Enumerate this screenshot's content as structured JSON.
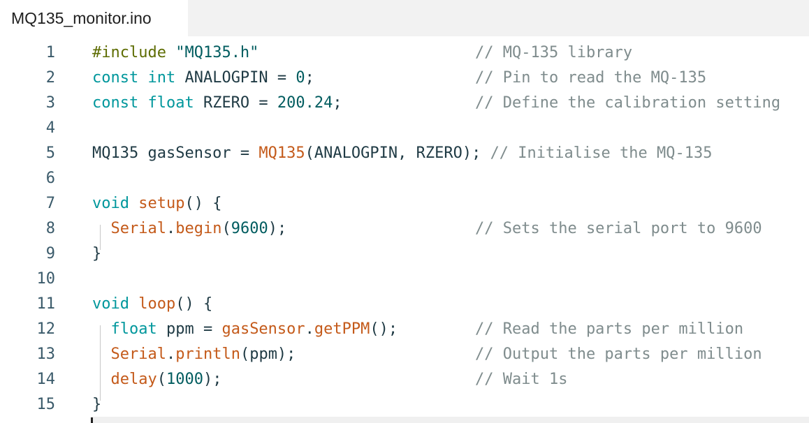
{
  "tab": {
    "title": "MQ135_monitor.ino"
  },
  "editor": {
    "lines": [
      {
        "n": "1",
        "tokens": [
          [
            "pp",
            "#include "
          ],
          [
            "str",
            "\"MQ135.h\""
          ]
        ],
        "comment": "// MQ-135 library"
      },
      {
        "n": "2",
        "tokens": [
          [
            "kw",
            "const int"
          ],
          [
            "tx",
            " ANALOGPIN = "
          ],
          [
            "num",
            "0"
          ],
          [
            "tx",
            ";"
          ]
        ],
        "comment": "// Pin to read the MQ-135"
      },
      {
        "n": "3",
        "tokens": [
          [
            "kw",
            "const float"
          ],
          [
            "tx",
            " RZERO = "
          ],
          [
            "num",
            "200.24"
          ],
          [
            "tx",
            ";"
          ]
        ],
        "comment": "// Define the calibration setting"
      },
      {
        "n": "4",
        "tokens": [],
        "comment": ""
      },
      {
        "n": "5",
        "tokens": [
          [
            "tx",
            "MQ135 gasSensor = "
          ],
          [
            "fn",
            "MQ135"
          ],
          [
            "tx",
            "(ANALOGPIN, RZERO); "
          ],
          [
            "ic",
            "// Initialise the MQ-135"
          ]
        ],
        "comment": ""
      },
      {
        "n": "6",
        "tokens": [],
        "comment": ""
      },
      {
        "n": "7",
        "tokens": [
          [
            "kw",
            "void"
          ],
          [
            "tx",
            " "
          ],
          [
            "fn",
            "setup"
          ],
          [
            "tx",
            "() {"
          ]
        ],
        "comment": ""
      },
      {
        "n": "8",
        "tokens": [
          [
            "tx",
            "  "
          ],
          [
            "fn",
            "Serial"
          ],
          [
            "tx",
            "."
          ],
          [
            "fn",
            "begin"
          ],
          [
            "tx",
            "("
          ],
          [
            "num",
            "9600"
          ],
          [
            "tx",
            ");"
          ]
        ],
        "comment": "// Sets the serial port to 9600"
      },
      {
        "n": "9",
        "tokens": [
          [
            "tx",
            "}"
          ]
        ],
        "comment": ""
      },
      {
        "n": "10",
        "tokens": [],
        "comment": ""
      },
      {
        "n": "11",
        "tokens": [
          [
            "kw",
            "void"
          ],
          [
            "tx",
            " "
          ],
          [
            "fn",
            "loop"
          ],
          [
            "tx",
            "() {"
          ]
        ],
        "comment": ""
      },
      {
        "n": "12",
        "tokens": [
          [
            "tx",
            "  "
          ],
          [
            "kw",
            "float"
          ],
          [
            "tx",
            " ppm = "
          ],
          [
            "fn",
            "gasSensor"
          ],
          [
            "tx",
            "."
          ],
          [
            "fn",
            "getPPM"
          ],
          [
            "tx",
            "();"
          ]
        ],
        "comment": "// Read the parts per million"
      },
      {
        "n": "13",
        "tokens": [
          [
            "tx",
            "  "
          ],
          [
            "fn",
            "Serial"
          ],
          [
            "tx",
            "."
          ],
          [
            "fn",
            "println"
          ],
          [
            "tx",
            "(ppm);"
          ]
        ],
        "comment": "// Output the parts per million"
      },
      {
        "n": "14",
        "tokens": [
          [
            "tx",
            "  "
          ],
          [
            "fn",
            "delay"
          ],
          [
            "tx",
            "("
          ],
          [
            "num",
            "1000"
          ],
          [
            "tx",
            ");"
          ]
        ],
        "comment": "// Wait 1s"
      },
      {
        "n": "15",
        "tokens": [
          [
            "tx",
            "}"
          ]
        ],
        "comment": ""
      }
    ]
  },
  "colors": {
    "keyword": "#00979c",
    "preprocessor": "#5e6d03",
    "function": "#c45a1a",
    "number": "#005c5f",
    "comment": "#7f8c8d",
    "text": "#1f3a44"
  }
}
